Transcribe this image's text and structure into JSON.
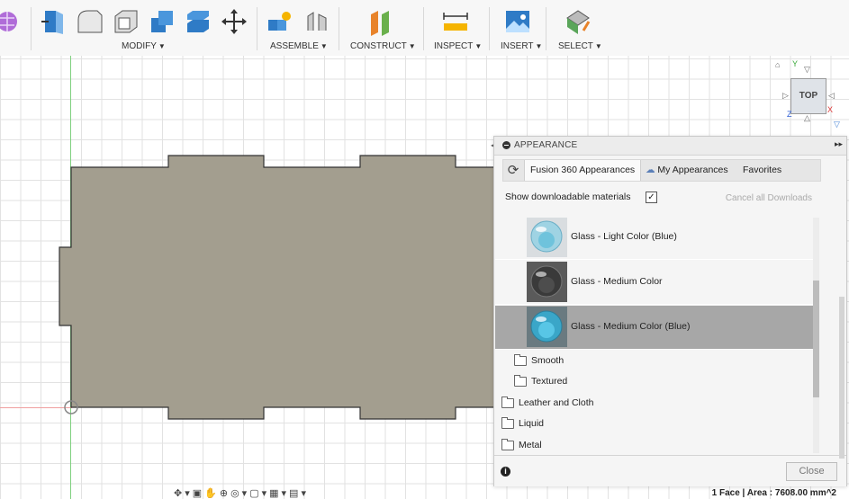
{
  "toolbar": {
    "groups": [
      {
        "label": "MODIFY"
      },
      {
        "label": "ASSEMBLE"
      },
      {
        "label": "CONSTRUCT"
      },
      {
        "label": "INSPECT"
      },
      {
        "label": "INSERT"
      },
      {
        "label": "SELECT"
      }
    ],
    "icons": [
      "create-form-icon",
      "press-pull-icon",
      "fillet-icon",
      "shell-icon",
      "combine-icon",
      "split-body-icon",
      "move-icon",
      "new-component-icon",
      "joint-icon",
      "offset-plane-icon",
      "measure-icon",
      "insert-image-icon",
      "select-icon"
    ]
  },
  "viewcube": {
    "face": "TOP",
    "axis_x": "X",
    "axis_y": "Y",
    "axis_z": "Z"
  },
  "appearance_panel": {
    "title": "APPEARANCE",
    "tabs": [
      "Fusion 360 Appearances",
      "My Appearances",
      "Favorites"
    ],
    "active_tab": "Fusion 360 Appearances",
    "show_downloadable_label": "Show downloadable materials",
    "show_downloadable_checked": true,
    "cancel_downloads_label": "Cancel all Downloads",
    "materials": [
      {
        "name": "Glass - Light Color (Blue)",
        "selected": false
      },
      {
        "name": "Glass - Medium Color",
        "selected": false
      },
      {
        "name": "Glass - Medium Color (Blue)",
        "selected": true
      }
    ],
    "subfolders": [
      "Smooth",
      "Textured"
    ],
    "folders": [
      "Leather and Cloth",
      "Liquid",
      "Metal"
    ],
    "close_label": "Close"
  },
  "status": {
    "selection": "1 Face | Area : 7608.00 mm^2"
  },
  "colors": {
    "sketch_fill": "#a39e8f",
    "selected_row": "#a7a7a7",
    "axis_green": "#7fd07f"
  }
}
